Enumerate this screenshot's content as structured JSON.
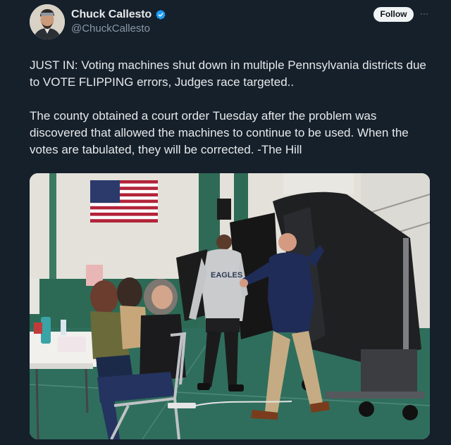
{
  "author": {
    "display_name": "Chuck Callesto",
    "handle": "@ChuckCallesto",
    "verified": true,
    "avatar_icon": "profile-photo"
  },
  "actions": {
    "follow_label": "Follow",
    "more_icon": "more-horizontal-icon",
    "more_glyph": "···"
  },
  "tweet": {
    "paragraph_1": "JUST IN: Voting machines shut down in multiple Pennsylvania districts due to VOTE FLIPPING errors, Judges race targeted..",
    "paragraph_2": "The county obtained a court order Tuesday after the problem was discovered that allowed the machines to continue to be used. When the votes are tabulated, they will be corrected. -The Hill"
  },
  "media": {
    "shirt_text": "EAGLES"
  },
  "colors": {
    "background": "#15202b",
    "text": "#e7e9ea",
    "secondary_text": "#8b98a5",
    "verified_badge": "#1d9bf0",
    "follow_button_bg": "#eff3f4",
    "floor_green": "#2f6e5c"
  }
}
